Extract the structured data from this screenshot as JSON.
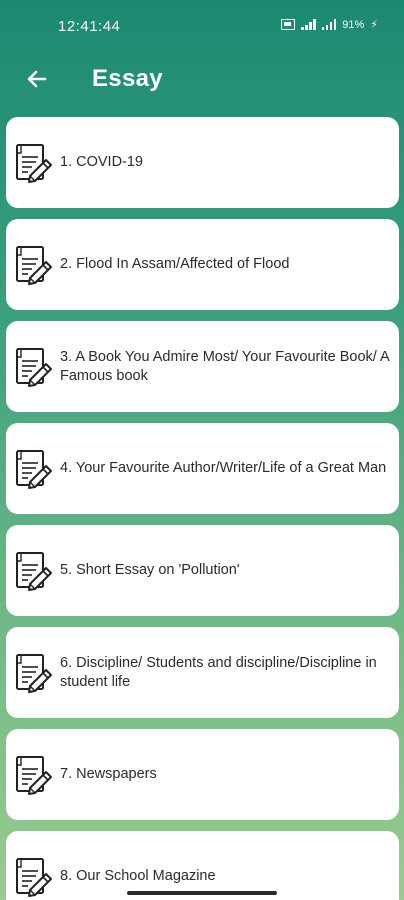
{
  "status_bar": {
    "time": "12:41:44",
    "battery": "91%"
  },
  "app_bar": {
    "title": "Essay",
    "back_icon": "arrow-left-icon"
  },
  "essays": [
    {
      "label": "1. COVID-19"
    },
    {
      "label": "2. Flood In Assam/Affected of Flood"
    },
    {
      "label": "3. A Book You Admire Most/ Your Favourite Book/ A Famous book"
    },
    {
      "label": "4. Your Favourite Author/Writer/Life of a Great Man"
    },
    {
      "label": "5. Short Essay on 'Pollution'"
    },
    {
      "label": "6. Discipline/ Students and discipline/Discipline in student life"
    },
    {
      "label": "7. Newspapers"
    },
    {
      "label": "8. Our School Magazine"
    }
  ],
  "colors": {
    "gradient_top": "#1b8a72",
    "gradient_bottom": "#9acb90",
    "card": "#ffffff",
    "text": "#2b2b2b"
  },
  "item_icon": "document-pen-icon"
}
